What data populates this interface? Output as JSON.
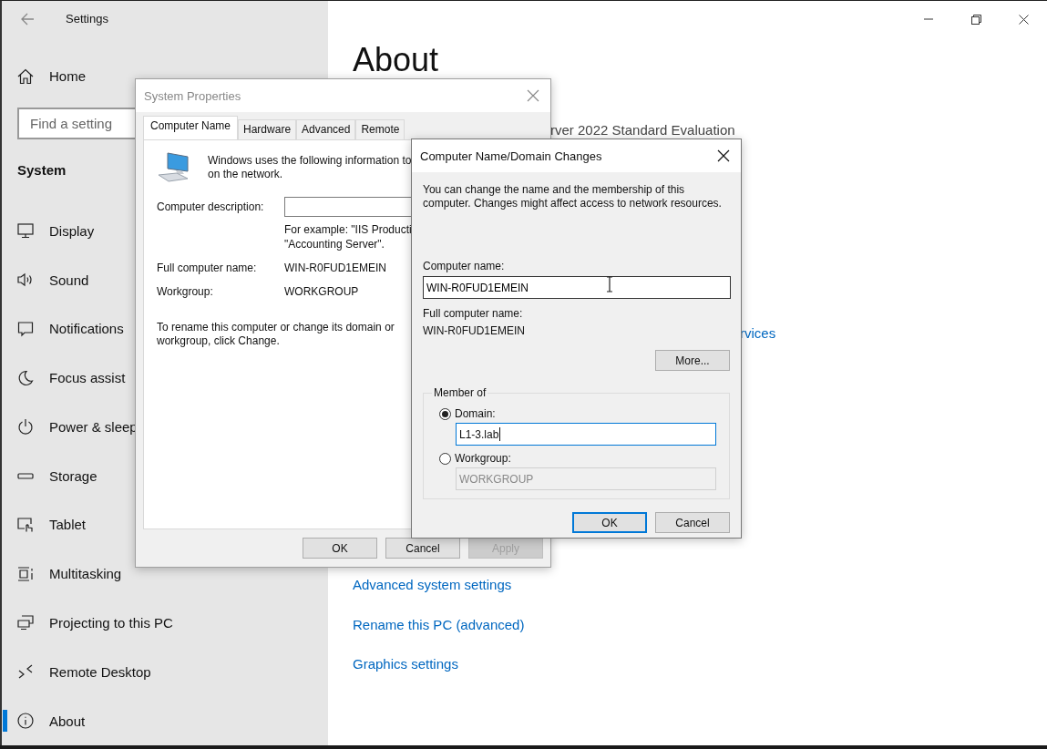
{
  "settings": {
    "title": "Settings",
    "sidebar": {
      "home": "Home",
      "search": {
        "placeholder": "Find a setting"
      },
      "section": "System",
      "items": [
        {
          "label": "Display",
          "kind": "display",
          "selected": false
        },
        {
          "label": "Sound",
          "kind": "sound",
          "selected": false
        },
        {
          "label": "Notifications",
          "kind": "notifications",
          "selected": false
        },
        {
          "label": "Focus assist",
          "kind": "focus",
          "selected": false
        },
        {
          "label": "Power & sleep",
          "kind": "power",
          "selected": false
        },
        {
          "label": "Storage",
          "kind": "storage",
          "selected": false
        },
        {
          "label": "Tablet",
          "kind": "tablet",
          "selected": false
        },
        {
          "label": "Multitasking",
          "kind": "multitasking",
          "selected": false
        },
        {
          "label": "Projecting to this PC",
          "kind": "projecting",
          "selected": false
        },
        {
          "label": "Remote Desktop",
          "kind": "remote",
          "selected": false
        },
        {
          "label": "About",
          "kind": "about",
          "selected": true
        }
      ]
    },
    "content": {
      "heading": "About",
      "edition": "rver 2022 Standard Evaluation",
      "services_link": "rvices",
      "links": [
        "Advanced system settings",
        "Rename this PC (advanced)",
        "Graphics settings"
      ]
    }
  },
  "system_properties": {
    "title": "System Properties",
    "tabs": [
      {
        "label": "Computer Name",
        "selected": true
      },
      {
        "label": "Hardware",
        "selected": false
      },
      {
        "label": "Advanced",
        "selected": false
      },
      {
        "label": "Remote",
        "selected": false
      }
    ],
    "intro_lines": [
      "Windows uses the following information to",
      "on the network."
    ],
    "description_label": "Computer description:",
    "description_example": [
      "For example: \"IIS Producti",
      "\"Accounting Server\"."
    ],
    "details": [
      {
        "label": "Full computer name:",
        "value": "WIN-R0FUD1EMEIN"
      },
      {
        "label": "Workgroup:",
        "value": "WORKGROUP"
      }
    ],
    "rename_note": [
      "To rename this computer or change its domain or",
      "workgroup, click Change."
    ],
    "buttons": [
      {
        "label": "OK",
        "disabled": false
      },
      {
        "label": "Cancel",
        "disabled": false
      },
      {
        "label": "Apply",
        "disabled": true
      }
    ]
  },
  "name_changes": {
    "title": "Computer Name/Domain Changes",
    "message": [
      "You can change the name and the membership of this",
      "computer. Changes might affect access to network resources."
    ],
    "computer_name_label": "Computer name:",
    "computer_name_value": "WIN-R0FUD1EMEIN",
    "full_name_label": "Full computer name:",
    "full_name_value": "WIN-R0FUD1EMEIN",
    "more_button": "More...",
    "member_of": {
      "legend": "Member of",
      "options": [
        {
          "label": "Domain:",
          "selected": true,
          "value": "L1-3.lab"
        },
        {
          "label": "Workgroup:",
          "selected": false,
          "value": "WORKGROUP"
        }
      ]
    },
    "buttons": [
      {
        "label": "OK",
        "default": true
      },
      {
        "label": "Cancel",
        "default": false
      }
    ]
  }
}
